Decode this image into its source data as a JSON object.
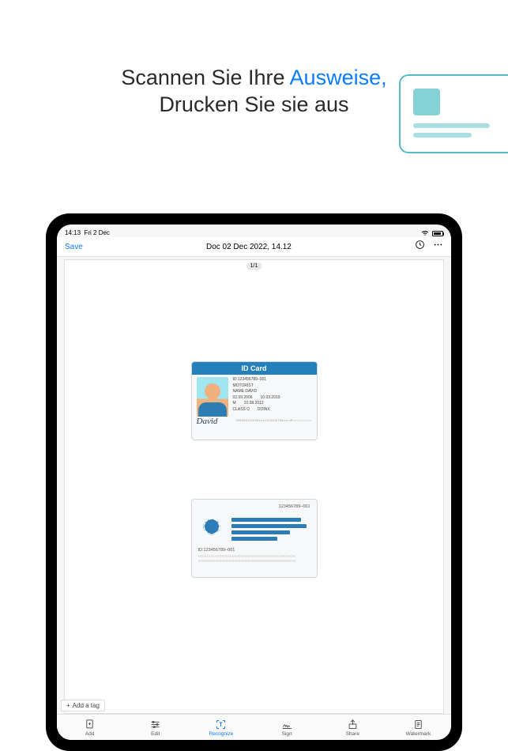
{
  "decor": {
    "card": true
  },
  "headline": {
    "part1": "Scannen Sie Ihre ",
    "highlight": "Ausweise,",
    "part2": "Drucken Sie sie aus"
  },
  "statusbar": {
    "time": "14:13",
    "date": "Fri 2 Dec"
  },
  "navbar": {
    "save": "Save",
    "title": "Doc 02 Dec 2022, 14.12"
  },
  "page": {
    "counter": "1/1"
  },
  "id_front": {
    "title": "ID Card",
    "id": "ID:123456789–001",
    "motorist": "MOTORIST",
    "name": "NAME DAVID",
    "dob_l": "02.09.2006",
    "dob_r": "10.03.2019",
    "sex_l": "M",
    "sex_r": "10.08.2012",
    "cls_l": "CLASS D",
    "cls_r": "DOINX",
    "signature": "David",
    "mrz": "0000DAVID020xxxx123456789xxxxM<<<<<<<<<<"
  },
  "id_back": {
    "top_id": "123456789–001",
    "bottom_id": "ID:123456789–001",
    "mrz1": "<<<<<<<<<<<<<<<<<<<<<<<<<<<<<<<<<<<<<<<<<<<<<<",
    "mrz2": "<<<<<<<<<<<<<<<<<<<<<<<<<<<<<<<<<<<<<<<<<<<<<<"
  },
  "add_tag": {
    "plus": "+",
    "label": "Add a tag"
  },
  "bottombar": {
    "items": [
      {
        "label": "Add"
      },
      {
        "label": "Edit"
      },
      {
        "label": "Recognize"
      },
      {
        "label": "Sign"
      },
      {
        "label": "Share"
      },
      {
        "label": "Watermark"
      }
    ]
  }
}
